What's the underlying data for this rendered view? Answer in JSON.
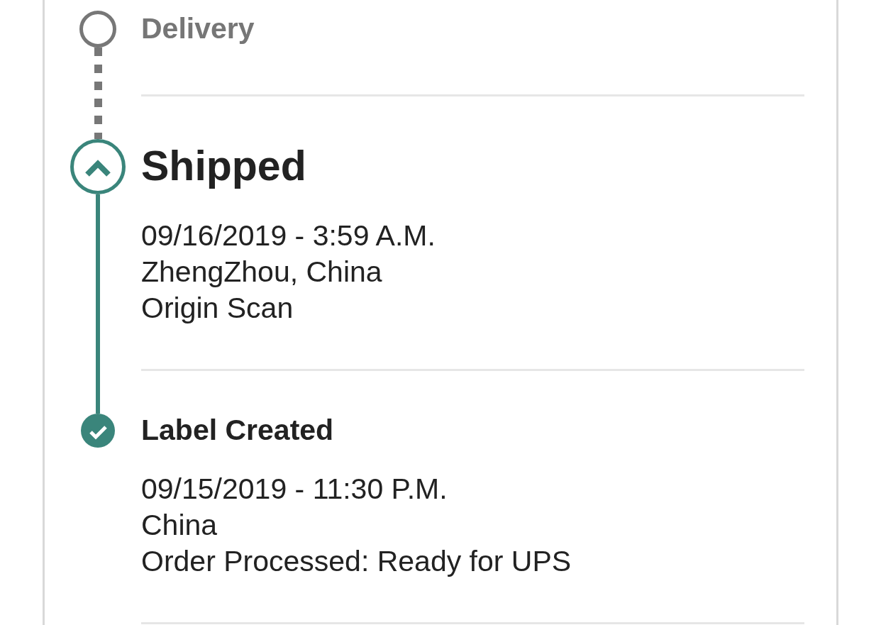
{
  "events": [
    {
      "kind": "pending",
      "title": "Delivery"
    },
    {
      "kind": "current",
      "title": "Shipped",
      "date_time": "09/16/2019 - 3:59 A.M.",
      "location": "ZhengZhou, China",
      "description": "Origin Scan"
    },
    {
      "kind": "done",
      "title": "Label Created",
      "date_time": "09/15/2019 - 11:30 P.M.",
      "location": "China",
      "description": "Order Processed: Ready for UPS"
    }
  ]
}
